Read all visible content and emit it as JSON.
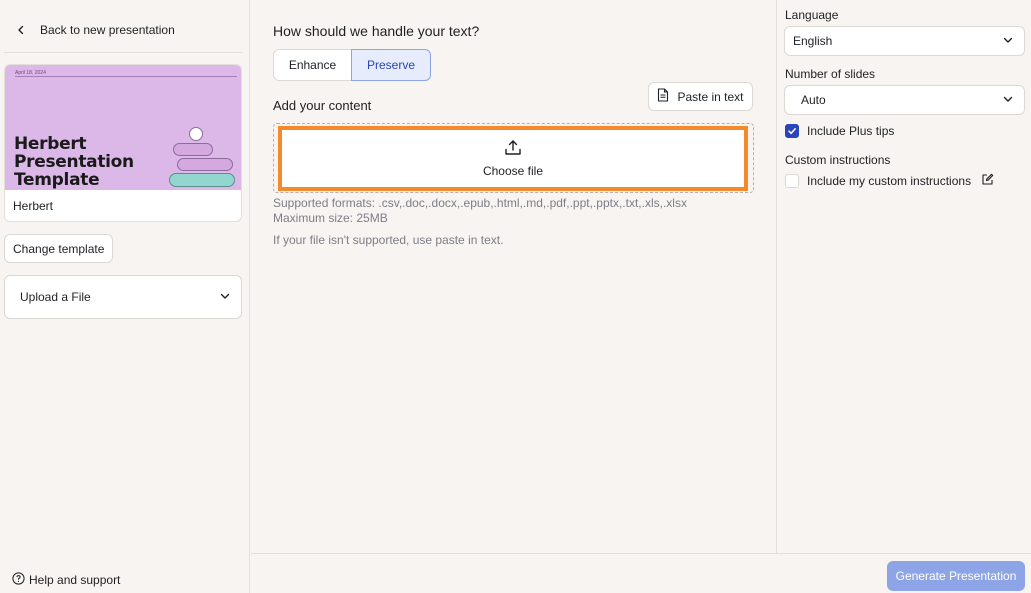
{
  "sidebar": {
    "back_label": "Back to new presentation",
    "template": {
      "thumb_date": "April 18, 2024",
      "thumb_title_lines": [
        "Herbert",
        "Presentation",
        "Template"
      ],
      "name": "Herbert",
      "colors": {
        "background": "#dcb8e8",
        "accent": "#93d5cf"
      }
    },
    "change_template_label": "Change template",
    "upload_dropdown_label": "Upload a File",
    "help_label": "Help and support"
  },
  "main": {
    "handle_heading": "How should we handle your text?",
    "modes": [
      {
        "label": "Enhance",
        "selected": false
      },
      {
        "label": "Preserve",
        "selected": true
      }
    ],
    "content_heading": "Add your content",
    "paste_label": "Paste in text",
    "choose_file_label": "Choose file",
    "formats_text": "Supported formats: .csv,.doc,.docx,.epub,.html,.md,.pdf,.ppt,.pptx,.txt,.xls,.xlsx",
    "max_size_text": "Maximum size: 25MB",
    "unsupported_note": "If your file isn't supported, use paste in text.",
    "highlight_color": "#f58a2c"
  },
  "settings": {
    "language_label": "Language",
    "language_value": "English",
    "slides_label": "Number of slides",
    "slides_value": "Auto",
    "plus_tips_label": "Include Plus tips",
    "plus_tips_checked": true,
    "custom_heading": "Custom instructions",
    "custom_label": "Include my custom instructions",
    "custom_checked": false
  },
  "footer": {
    "generate_label": "Generate Presentation",
    "accent_color": "#8da4e6"
  }
}
